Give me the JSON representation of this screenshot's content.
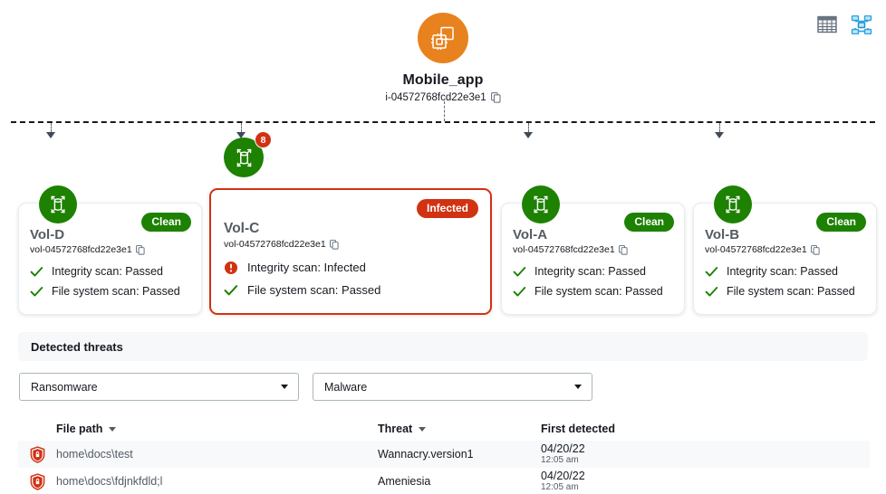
{
  "view_toggle": {
    "table_view": {
      "name": "table-view",
      "active": false
    },
    "topology_view": {
      "name": "topology-view",
      "active": true
    }
  },
  "instance": {
    "name": "Mobile_app",
    "id": "i-04572768fcd22e3e1",
    "icon": "instance-chip-icon",
    "copy_icon": "copy-icon",
    "color": "#e8821e"
  },
  "volumes": [
    {
      "name": "Vol-D",
      "id": "vol-04572768fcd22e3e1",
      "status": "Clean",
      "status_color": "#1d8102",
      "badge_count": null,
      "scans": [
        {
          "label": "Integrity scan: Passed",
          "result": "passed"
        },
        {
          "label": "File system scan: Passed",
          "result": "passed"
        }
      ]
    },
    {
      "name": "Vol-C",
      "id": "vol-04572768fcd22e3e1",
      "status": "Infected",
      "status_color": "#d13212",
      "badge_count": "8",
      "scans": [
        {
          "label": "Integrity scan: Infected",
          "result": "infected"
        },
        {
          "label": "File system scan: Passed",
          "result": "passed"
        }
      ]
    },
    {
      "name": "Vol-A",
      "id": "vol-04572768fcd22e3e1",
      "status": "Clean",
      "status_color": "#1d8102",
      "badge_count": null,
      "scans": [
        {
          "label": "Integrity scan: Passed",
          "result": "passed"
        },
        {
          "label": "File system scan: Passed",
          "result": "passed"
        }
      ]
    },
    {
      "name": "Vol-B",
      "id": "vol-04572768fcd22e3e1",
      "status": "Clean",
      "status_color": "#1d8102",
      "badge_count": null,
      "scans": [
        {
          "label": "Integrity scan: Passed",
          "result": "passed"
        },
        {
          "label": "File system scan: Passed",
          "result": "passed"
        }
      ]
    }
  ],
  "threats": {
    "title": "Detected threats",
    "filters": [
      {
        "name": "threat-category-select",
        "value": "Ransomware"
      },
      {
        "name": "threat-type-select",
        "value": "Malware"
      }
    ],
    "columns": [
      {
        "label": "File path",
        "sortable": true
      },
      {
        "label": "Threat",
        "sortable": true
      },
      {
        "label": "First detected",
        "sortable": false
      }
    ],
    "rows": [
      {
        "icon": "shield-lock-icon",
        "file_path": "home\\docs\\test",
        "threat": "Wannacry.version1",
        "date": "04/20/22",
        "time": "12:05 am"
      },
      {
        "icon": "shield-lock-icon",
        "file_path": "home\\docs\\fdjnkfdld;l",
        "threat": "Ameniesia",
        "date": "04/20/22",
        "time": "12:05 am"
      }
    ]
  }
}
